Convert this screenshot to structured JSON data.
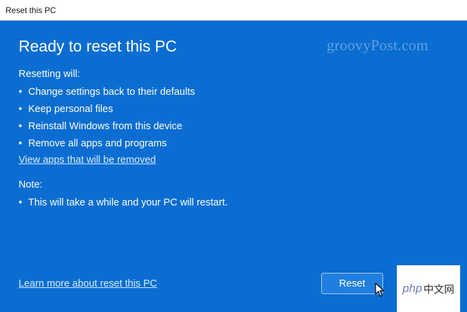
{
  "window": {
    "title": "Reset this PC"
  },
  "watermark": "groovyPost.com",
  "main": {
    "heading": "Ready to reset this PC",
    "intro": "Resetting will:",
    "bullets": [
      "Change settings back to their defaults",
      "Keep personal files",
      "Reinstall Windows from this device",
      "Remove all apps and programs"
    ],
    "view_apps_link": "View apps that will be removed",
    "note_label": "Note:",
    "notes": [
      "This will take a while and your PC will restart."
    ],
    "learn_more_link": "Learn more about reset this PC",
    "reset_label": "Reset"
  },
  "logo": {
    "php_text": "php",
    "cn_text": "中文网"
  },
  "colors": {
    "background": "#0b6dd1",
    "button": "#1f7fe0",
    "link": "#d7ecff"
  }
}
